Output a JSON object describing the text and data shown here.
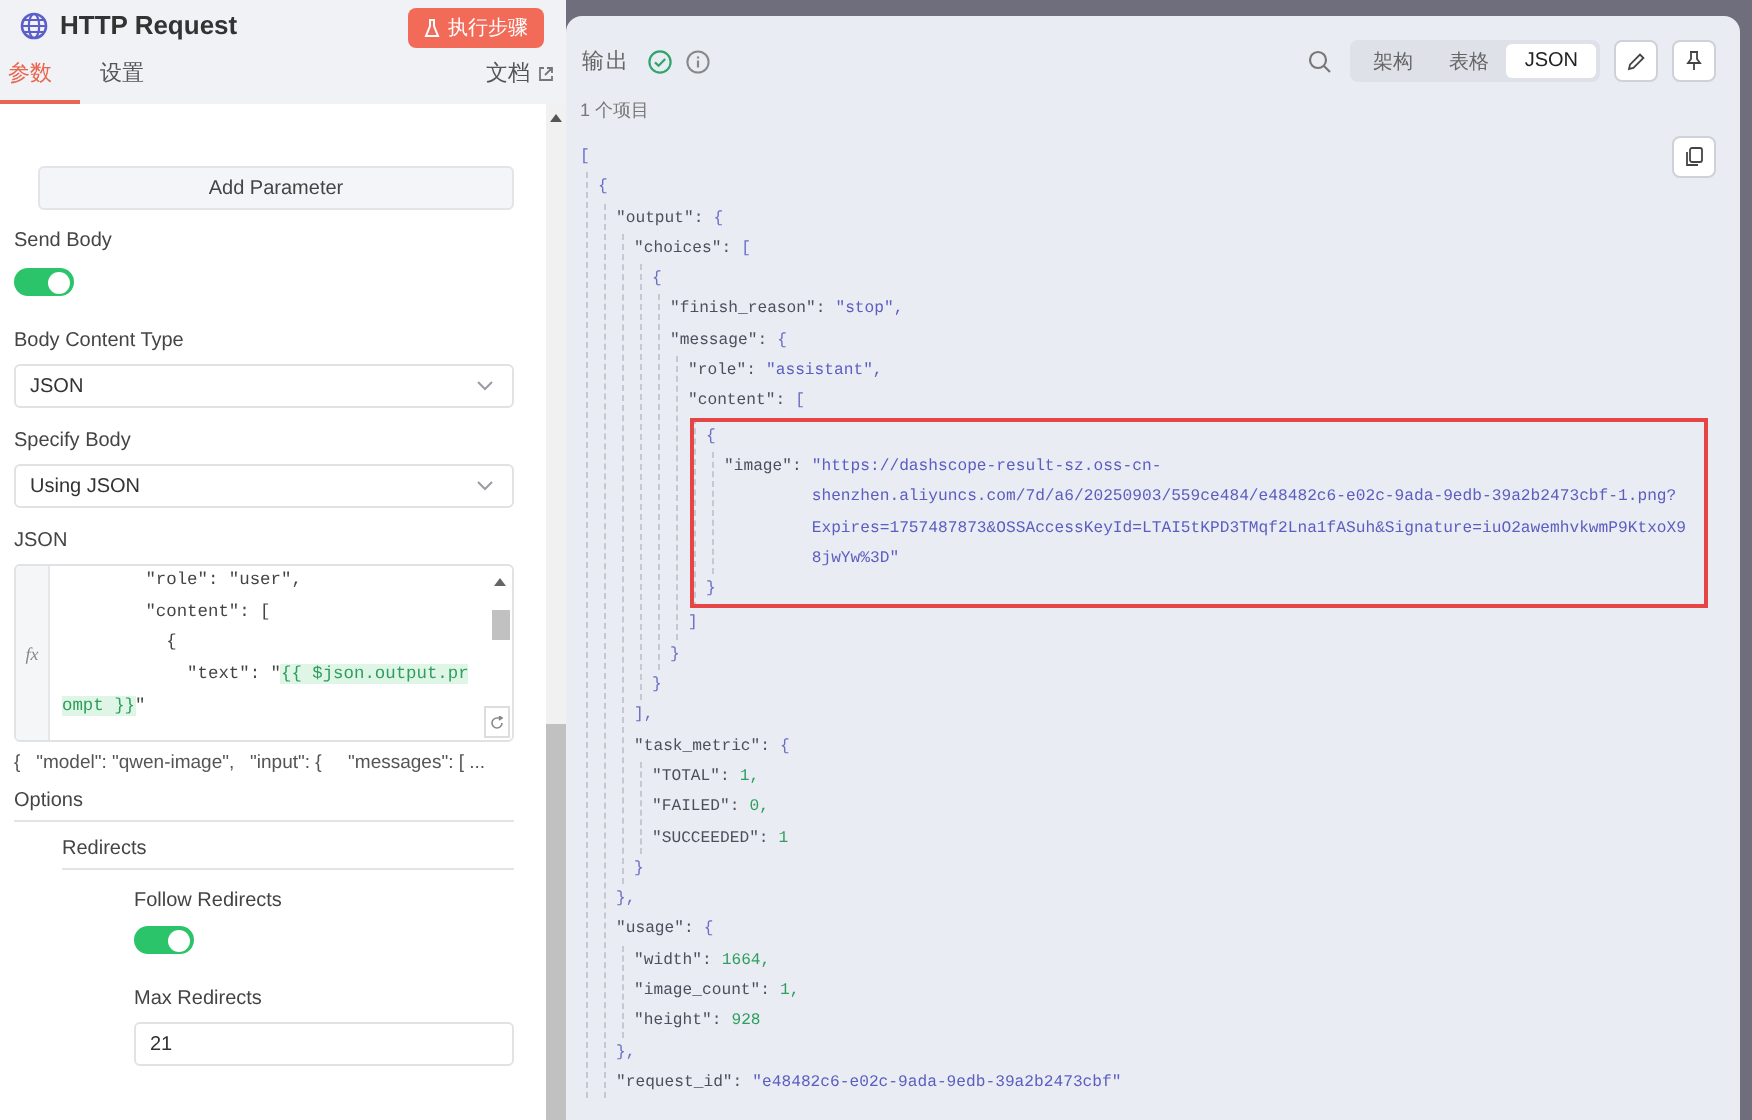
{
  "node_panel": {
    "title": "HTTP Request",
    "run_button": "执行步骤",
    "tabs": [
      {
        "label": "参数",
        "selected": true
      },
      {
        "label": "设置",
        "selected": false
      }
    ],
    "docs_link": "文档",
    "add_parameter_button": "Add Parameter",
    "send_body": {
      "label": "Send Body",
      "on": true
    },
    "body_content_type": {
      "label": "Body Content Type",
      "value": "JSON"
    },
    "specify_body": {
      "label": "Specify Body",
      "value": "Using JSON"
    },
    "json_field": {
      "label": "JSON",
      "gutter": "fx",
      "lines": [
        [
          {
            "kind": "plain",
            "text": "        \"role\": \"user\","
          }
        ],
        [
          {
            "kind": "plain",
            "text": "        \"content\": ["
          }
        ],
        [
          {
            "kind": "plain",
            "text": "          {"
          }
        ],
        [
          {
            "kind": "plain",
            "text": "            \"text\": \""
          },
          {
            "kind": "expression",
            "text": "{{ $json.output.pr"
          }
        ],
        [
          {
            "kind": "expression",
            "text": "ompt }}"
          },
          {
            "kind": "plain",
            "text": "\""
          }
        ]
      ],
      "preview": "{   \"model\": \"qwen-image\",   \"input\": {     \"messages\": [ ..."
    },
    "options": {
      "title": "Options",
      "groups": [
        {
          "title": "Redirects",
          "fields": [
            {
              "kind": "toggle",
              "label": "Follow Redirects",
              "on": true
            },
            {
              "kind": "number",
              "label": "Max Redirects",
              "value": "21"
            }
          ]
        }
      ]
    }
  },
  "output_panel": {
    "title": "输出",
    "views": [
      {
        "label": "架构",
        "selected": false
      },
      {
        "label": "表格",
        "selected": false
      },
      {
        "label": "JSON",
        "selected": true
      }
    ],
    "item_count": "1 个项目",
    "json_tree": {
      "open": "[",
      "children": [
        {
          "open": "{",
          "children": [
            {
              "key": "\"output\":",
              "open": "{",
              "children": [
                {
                  "key": "\"choices\":",
                  "open": "[",
                  "children": [
                    {
                      "open": "{",
                      "children": [
                        {
                          "key": "\"finish_reason\":",
                          "kind": "string",
                          "value": "\"stop\","
                        },
                        {
                          "key": "\"message\":",
                          "open": "{",
                          "children": [
                            {
                              "key": "\"role\":",
                              "kind": "string",
                              "value": "\"assistant\","
                            },
                            {
                              "key": "\"content\":",
                              "open": "[",
                              "children": [
                                {
                                  "open": "{",
                                  "highlighted": true,
                                  "children": [
                                    {
                                      "key": "\"image\":",
                                      "kind": "string",
                                      "value_lines": [
                                        "\"https://dashscope-result-sz.oss-cn-",
                                        "shenzhen.aliyuncs.com/7d/a6/20250903/559ce484/e48482c6-e02c-9ada-9edb-39a2b2473cbf-1.png?",
                                        "Expires=1757487873&OSSAccessKeyId=LTAI5tKPD3TMqf2Lna1fASuh&Signature=iuO2awemhvkwmP9KtxoX9",
                                        "8jwYw%3D\""
                                      ]
                                    }
                                  ],
                                  "close": "}"
                                }
                              ],
                              "close": "]"
                            }
                          ],
                          "close": "}"
                        }
                      ],
                      "close": "}"
                    }
                  ],
                  "close": "],"
                },
                {
                  "key": "\"task_metric\":",
                  "open": "{",
                  "children": [
                    {
                      "key": "\"TOTAL\":",
                      "kind": "number",
                      "value": "1,"
                    },
                    {
                      "key": "\"FAILED\":",
                      "kind": "number",
                      "value": "0,"
                    },
                    {
                      "key": "\"SUCCEEDED\":",
                      "kind": "number",
                      "value": "1"
                    }
                  ],
                  "close": "}"
                }
              ],
              "close": "},"
            },
            {
              "key": "\"usage\":",
              "open": "{",
              "children": [
                {
                  "key": "\"width\":",
                  "kind": "number",
                  "value": "1664,"
                },
                {
                  "key": "\"image_count\":",
                  "kind": "number",
                  "value": "1,"
                },
                {
                  "key": "\"height\":",
                  "kind": "number",
                  "value": "928"
                }
              ],
              "close": "},"
            },
            {
              "key": "\"request_id\":",
              "kind": "string",
              "value": "\"e48482c6-e02c-9ada-9edb-39a2b2473cbf\""
            }
          ]
        }
      ]
    }
  }
}
